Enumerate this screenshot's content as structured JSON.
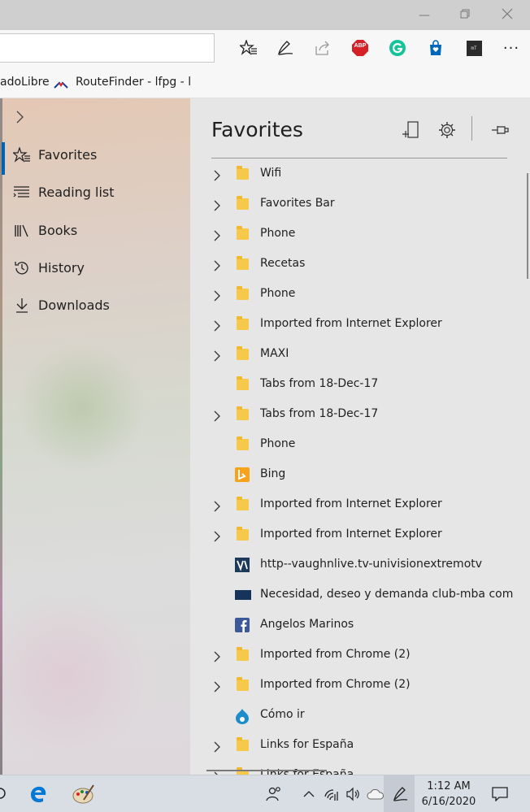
{
  "window": {
    "buttons": [
      "minimize-icon",
      "restore-icon",
      "close-icon"
    ]
  },
  "toolbar": {
    "address_value": "",
    "icons": [
      "favorites-star-icon",
      "pen-icon",
      "share-icon",
      "adblock-icon",
      "grammarly-icon",
      "shopping-bag-icon",
      "extension-icon",
      "more-icon"
    ],
    "abp_label": "ABP",
    "mt_label": "mT",
    "more_label": "···"
  },
  "favorites_bar": {
    "items": [
      {
        "label": "adoLibre"
      },
      {
        "label": "RouteFinder - lfpg - l"
      }
    ]
  },
  "hub": {
    "nav": [
      {
        "label": "Favorites",
        "icon": "favorites-star-icon",
        "active": true
      },
      {
        "label": "Reading list",
        "icon": "reading-list-icon",
        "active": false
      },
      {
        "label": "Books",
        "icon": "books-icon",
        "active": false
      },
      {
        "label": "History",
        "icon": "history-icon",
        "active": false
      },
      {
        "label": "Downloads",
        "icon": "download-icon",
        "active": false
      }
    ]
  },
  "favorites": {
    "title": "Favorites",
    "items": [
      {
        "label": "Wifi",
        "expandable": true,
        "icon": "folder"
      },
      {
        "label": "Favorites Bar",
        "expandable": true,
        "icon": "folder"
      },
      {
        "label": "Phone",
        "expandable": true,
        "icon": "folder"
      },
      {
        "label": "Recetas",
        "expandable": true,
        "icon": "folder"
      },
      {
        "label": "Phone",
        "expandable": true,
        "icon": "folder"
      },
      {
        "label": "Imported from Internet Explorer",
        "expandable": true,
        "icon": "folder"
      },
      {
        "label": "MAXI",
        "expandable": true,
        "icon": "folder"
      },
      {
        "label": "Tabs from 18-Dec-17",
        "expandable": false,
        "icon": "folder"
      },
      {
        "label": "Tabs from 18-Dec-17",
        "expandable": true,
        "icon": "folder"
      },
      {
        "label": "Phone",
        "expandable": false,
        "icon": "folder"
      },
      {
        "label": "Bing",
        "expandable": false,
        "icon": "bing"
      },
      {
        "label": "Imported from Internet Explorer",
        "expandable": true,
        "icon": "folder"
      },
      {
        "label": "Imported from Internet Explorer",
        "expandable": true,
        "icon": "folder"
      },
      {
        "label": "http--vaughnlive.tv-univisionextremotv",
        "expandable": false,
        "icon": "vaughn"
      },
      {
        "label": "Necesidad, deseo y demanda   club-mba com",
        "expandable": false,
        "icon": "mba"
      },
      {
        "label": "Angelos Marinos",
        "expandable": false,
        "icon": "facebook"
      },
      {
        "label": "Imported from Chrome (2)",
        "expandable": true,
        "icon": "folder"
      },
      {
        "label": "Imported from Chrome (2)",
        "expandable": true,
        "icon": "folder"
      },
      {
        "label": "Cómo ir",
        "expandable": false,
        "icon": "drupal"
      },
      {
        "label": "Links for España",
        "expandable": true,
        "icon": "folder"
      },
      {
        "label": "Links for España",
        "expandable": true,
        "icon": "folder"
      }
    ]
  },
  "taskbar": {
    "time": "1:12 AM",
    "date": "6/16/2020"
  },
  "colors": {
    "accent": "#0063b1",
    "folder": "#f7c94a"
  }
}
